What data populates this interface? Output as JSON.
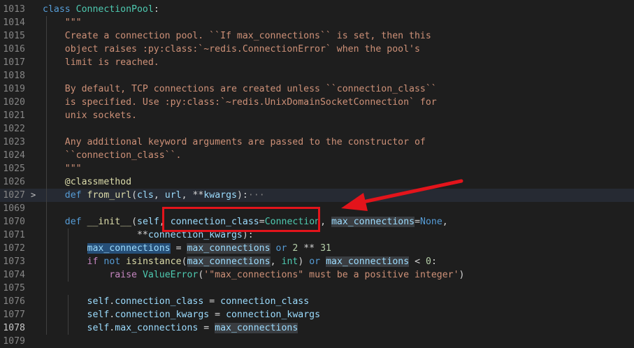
{
  "editor": {
    "lines": [
      {
        "num": "1013",
        "tokens": [
          [
            "class",
            "kw"
          ],
          [
            " ",
            "pl"
          ],
          [
            "ConnectionPool",
            "cls"
          ],
          [
            ":",
            "pl"
          ]
        ]
      },
      {
        "num": "1014",
        "tokens": [
          [
            "    \"\"\"",
            "str"
          ]
        ]
      },
      {
        "num": "1015",
        "tokens": [
          [
            "    Create a connection pool. ``If max_connections`` is set, then this",
            "str"
          ]
        ]
      },
      {
        "num": "1016",
        "tokens": [
          [
            "    object raises :py:class:`~redis.ConnectionError` when the pool's",
            "str"
          ]
        ]
      },
      {
        "num": "1017",
        "tokens": [
          [
            "    limit is reached.",
            "str"
          ]
        ]
      },
      {
        "num": "1018",
        "tokens": []
      },
      {
        "num": "1019",
        "tokens": [
          [
            "    By default, TCP connections are created unless ``connection_class``",
            "str"
          ]
        ]
      },
      {
        "num": "1020",
        "tokens": [
          [
            "    is specified. Use :py:class:`~redis.UnixDomainSocketConnection` for",
            "str"
          ]
        ]
      },
      {
        "num": "1021",
        "tokens": [
          [
            "    unix sockets.",
            "str"
          ]
        ]
      },
      {
        "num": "1022",
        "tokens": []
      },
      {
        "num": "1023",
        "tokens": [
          [
            "    Any additional keyword arguments are passed to the constructor of",
            "str"
          ]
        ]
      },
      {
        "num": "1024",
        "tokens": [
          [
            "    ``connection_class``.",
            "str"
          ]
        ]
      },
      {
        "num": "1025",
        "tokens": [
          [
            "    \"\"\"",
            "str"
          ]
        ]
      },
      {
        "num": "1026",
        "tokens": [
          [
            "    ",
            "pl"
          ],
          [
            "@classmethod",
            "fn"
          ]
        ]
      },
      {
        "num": "1027",
        "folded": true,
        "current": true,
        "tokens": [
          [
            "    ",
            "pl"
          ],
          [
            "def",
            "kw"
          ],
          [
            " ",
            "pl"
          ],
          [
            "from_url",
            "fn"
          ],
          [
            "(",
            "pl"
          ],
          [
            "cls",
            "par"
          ],
          [
            ", ",
            "pl"
          ],
          [
            "url",
            "par"
          ],
          [
            ", **",
            "pl"
          ],
          [
            "kwargs",
            "par"
          ],
          [
            "):",
            "pl"
          ],
          [
            "···",
            "dots"
          ]
        ]
      },
      {
        "num": "1069",
        "tokens": []
      },
      {
        "num": "1070",
        "tokens": [
          [
            "    ",
            "pl"
          ],
          [
            "def",
            "kw"
          ],
          [
            " ",
            "pl"
          ],
          [
            "__init__",
            "fn"
          ],
          [
            "(",
            "pl"
          ],
          [
            "self",
            "par"
          ],
          [
            ", ",
            "pl"
          ],
          [
            "connection_class",
            "par"
          ],
          [
            "=",
            "pl"
          ],
          [
            "Connection",
            "cls"
          ],
          [
            ", ",
            "pl"
          ],
          [
            "max_connections",
            "par hl"
          ],
          [
            "=",
            "pl"
          ],
          [
            "None",
            "kw"
          ],
          [
            ",",
            "pl"
          ]
        ]
      },
      {
        "num": "1071",
        "tokens": [
          [
            "                 **",
            "pl"
          ],
          [
            "connection_kwargs",
            "par"
          ],
          [
            "):",
            "pl"
          ]
        ]
      },
      {
        "num": "1072",
        "tokens": [
          [
            "        ",
            "pl"
          ],
          [
            "max_connections",
            "par sel"
          ],
          [
            " = ",
            "pl"
          ],
          [
            "max_connections",
            "par hl"
          ],
          [
            " ",
            "pl"
          ],
          [
            "or",
            "kw"
          ],
          [
            " ",
            "pl"
          ],
          [
            "2",
            "num"
          ],
          [
            " ** ",
            "pl"
          ],
          [
            "31",
            "num"
          ]
        ]
      },
      {
        "num": "1073",
        "tokens": [
          [
            "        ",
            "pl"
          ],
          [
            "if",
            "ctl"
          ],
          [
            " ",
            "pl"
          ],
          [
            "not",
            "kw"
          ],
          [
            " ",
            "pl"
          ],
          [
            "isinstance",
            "fn"
          ],
          [
            "(",
            "pl"
          ],
          [
            "max_connections",
            "par hl"
          ],
          [
            ", ",
            "pl"
          ],
          [
            "int",
            "cls"
          ],
          [
            ") ",
            "pl"
          ],
          [
            "or",
            "kw"
          ],
          [
            " ",
            "pl"
          ],
          [
            "max_connections",
            "par hl"
          ],
          [
            " < ",
            "pl"
          ],
          [
            "0",
            "num"
          ],
          [
            ":",
            "pl"
          ]
        ]
      },
      {
        "num": "1074",
        "tokens": [
          [
            "            ",
            "pl"
          ],
          [
            "raise",
            "ctl"
          ],
          [
            " ",
            "pl"
          ],
          [
            "ValueError",
            "cls"
          ],
          [
            "(",
            "pl"
          ],
          [
            "'\"max_connections\" must be a positive integer'",
            "str"
          ],
          [
            ")",
            "pl"
          ]
        ]
      },
      {
        "num": "1075",
        "tokens": []
      },
      {
        "num": "1076",
        "tokens": [
          [
            "        ",
            "pl"
          ],
          [
            "self",
            "par"
          ],
          [
            ".",
            "pl"
          ],
          [
            "connection_class",
            "par"
          ],
          [
            " = ",
            "pl"
          ],
          [
            "connection_class",
            "par"
          ]
        ]
      },
      {
        "num": "1077",
        "tokens": [
          [
            "        ",
            "pl"
          ],
          [
            "self",
            "par"
          ],
          [
            ".",
            "pl"
          ],
          [
            "connection_kwargs",
            "par"
          ],
          [
            " = ",
            "pl"
          ],
          [
            "connection_kwargs",
            "par"
          ]
        ]
      },
      {
        "num": "1078",
        "active": true,
        "tokens": [
          [
            "        ",
            "pl"
          ],
          [
            "self",
            "par"
          ],
          [
            ".",
            "pl"
          ],
          [
            "max_connections",
            "par"
          ],
          [
            " = ",
            "pl"
          ],
          [
            "max_connections",
            "par hl"
          ]
        ]
      },
      {
        "num": "1079",
        "tokens": []
      }
    ]
  },
  "annotation": {
    "color": "#e3141b"
  }
}
